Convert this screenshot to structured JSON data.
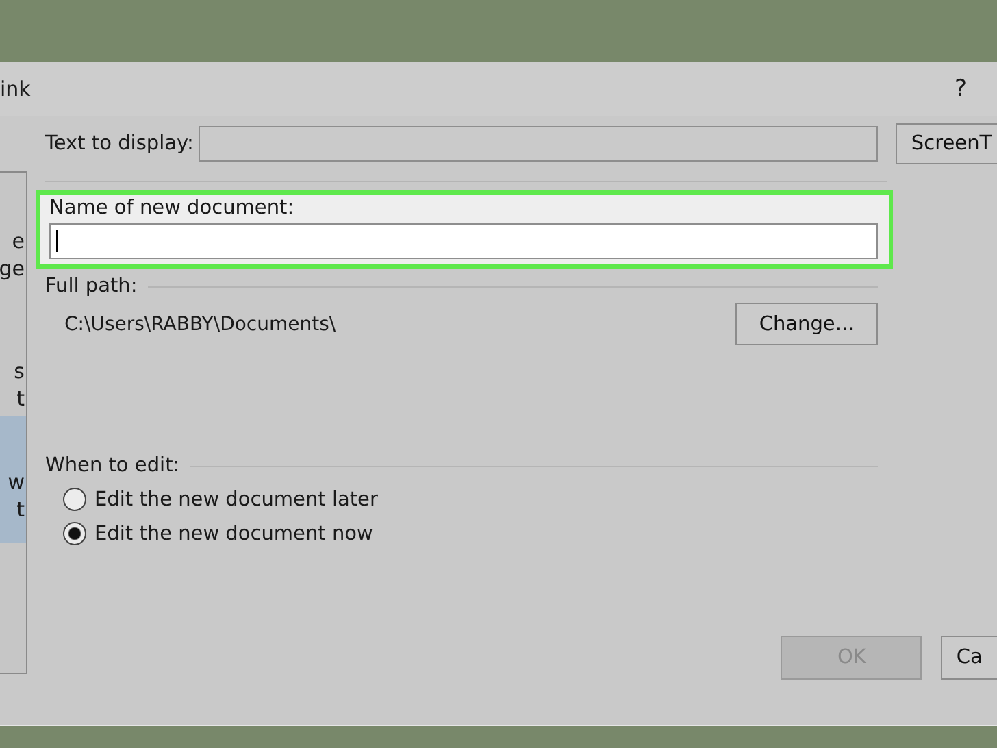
{
  "dialog": {
    "title": "ink",
    "help": "?"
  },
  "sidebar": {
    "items": [
      {
        "lines": [
          "e",
          "ge"
        ],
        "selected": false
      },
      {
        "lines": [
          "s",
          "t"
        ],
        "selected": false
      },
      {
        "lines": [
          "w",
          "t"
        ],
        "selected": true
      }
    ]
  },
  "text_to_display": {
    "label": "Text to display:"
  },
  "screentip_button": "ScreenT",
  "new_document": {
    "label": "Name of new document:",
    "highlighted": true
  },
  "full_path": {
    "label": "Full path:",
    "path": "C:\\Users\\RABBY\\Documents\\",
    "button": "Change..."
  },
  "when_to_edit": {
    "label": "When to edit:",
    "options": [
      {
        "label": "Edit the new document later",
        "selected": false
      },
      {
        "label": "Edit the new document now",
        "selected": true
      }
    ]
  },
  "buttons": [
    {
      "label": "OK",
      "disabled": true
    },
    {
      "label": "Ca",
      "disabled": false
    }
  ]
}
